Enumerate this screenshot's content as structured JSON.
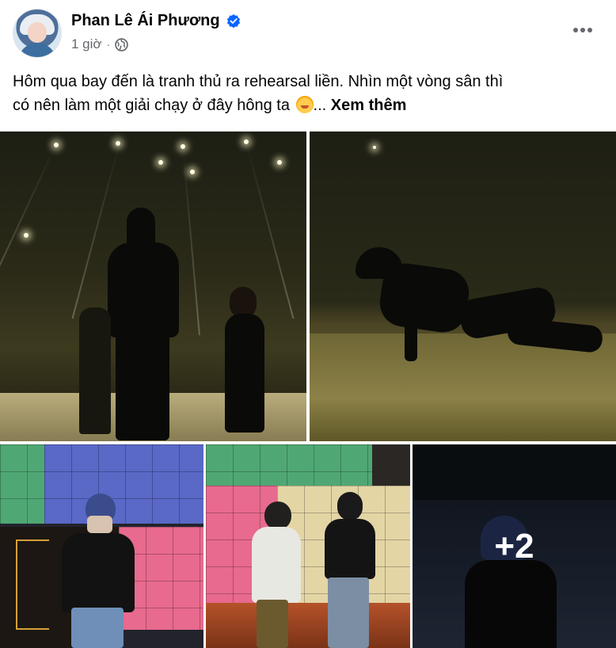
{
  "author": {
    "name": "Phan Lê Ái Phương",
    "verified": true,
    "timestamp": "1 giờ",
    "separator": "·",
    "privacy_icon": "globe-icon"
  },
  "post": {
    "text_line1": "Hôm qua bay đến là tranh thủ ra rehearsal liền. Nhìn một vòng sân thì",
    "text_line2": "có nên làm một giải chạy ở đây hông ta ",
    "ellipsis": "...",
    "see_more": "Xem thêm",
    "emoji": "smiling-face-with-hearts"
  },
  "photos": {
    "count": 5,
    "more_overlay": "+2"
  },
  "colors": {
    "verified_blue": "#0866ff",
    "meta_gray": "#65676b",
    "text": "#050505"
  }
}
